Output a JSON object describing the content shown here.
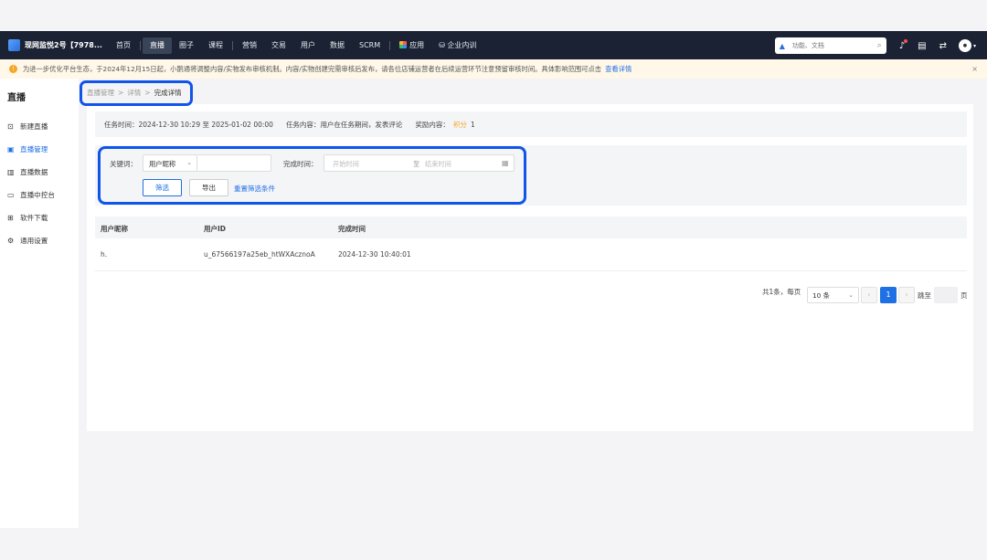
{
  "brand": {
    "name": "现网监悦2号【7978..."
  },
  "nav": {
    "items": [
      "首页",
      "直播",
      "圈子",
      "课程",
      "营销",
      "交易",
      "用户",
      "数据",
      "SCRM"
    ],
    "apps": "应用",
    "training": "企业内训"
  },
  "search": {
    "placeholder": "功能、文档"
  },
  "notice": {
    "text": "为进一步优化平台生态，于2024年12月15日起，小鹅通将调整内容/实物发布审核机制。内容/实物创建完需审核后发布，请各位店铺运营者在后续运营环节注意预留审核时间。具体影响范围可点击",
    "link": "查看详情",
    "close": "×"
  },
  "sidebar": {
    "title": "直播",
    "items": [
      {
        "label": "新建直播",
        "icon": "new-live-icon"
      },
      {
        "label": "直播管理",
        "icon": "live-manage-icon"
      },
      {
        "label": "直播数据",
        "icon": "live-data-icon"
      },
      {
        "label": "直播中控台",
        "icon": "console-icon"
      },
      {
        "label": "软件下载",
        "icon": "download-icon"
      },
      {
        "label": "通用设置",
        "icon": "settings-icon"
      }
    ]
  },
  "breadcrumb": {
    "items": [
      "直播管理",
      "详情",
      "完成详情"
    ],
    "sep": ">"
  },
  "task": {
    "time_label": "任务时间：",
    "time_value": "2024-12-30 10:29 至 2025-01-02 00:00",
    "content_label": "任务内容：",
    "content_value": "用户在任务期间，发表评论",
    "reward_label": "奖励内容：",
    "reward_type": "积分",
    "reward_value": "1"
  },
  "filter": {
    "keyword_label": "关键词：",
    "keyword_select": "用户昵称",
    "keyword_value": "",
    "time_label": "完成时间：",
    "start_placeholder": "开始时间",
    "range_sep": "至",
    "end_placeholder": "结束时间",
    "filter_button": "筛选",
    "export_button": "导出",
    "reset_link": "重置筛选条件"
  },
  "table": {
    "columns": [
      "用户昵称",
      "用户ID",
      "完成时间"
    ],
    "rows": [
      [
        "h.",
        "u_67566197a25eb_htWXAcznoA",
        "2024-12-30 10:40:01"
      ]
    ]
  },
  "pagination": {
    "summary": "共1条，每页",
    "page_size": "10 条",
    "current_page": "1",
    "jump_label": "跳至",
    "page_suffix": "页"
  },
  "colors": {
    "accent": "#1f6fe5",
    "highlight": "#0f55e8",
    "topbar": "#1a2233"
  }
}
